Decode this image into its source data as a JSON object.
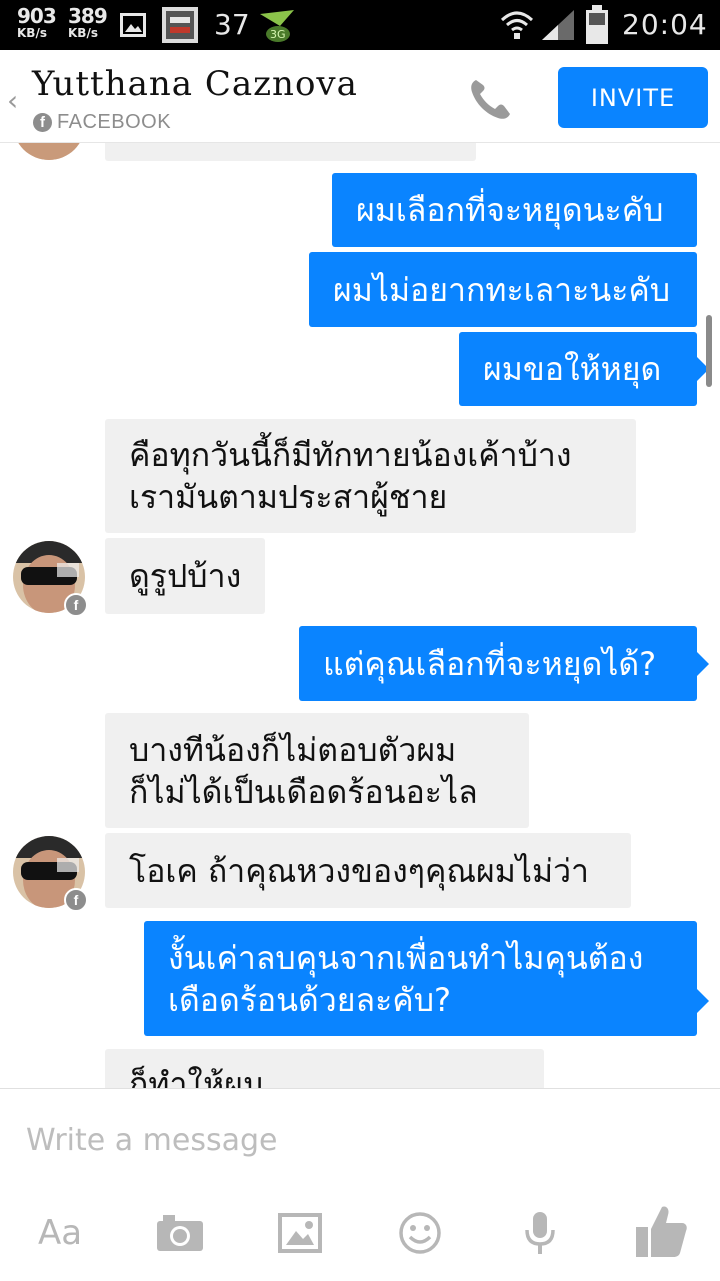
{
  "status_bar": {
    "down_speed": "903",
    "down_unit": "KB/s",
    "up_speed": "389",
    "up_unit": "KB/s",
    "notification_count": "37",
    "time": "20:04"
  },
  "header": {
    "back": "‹",
    "contact_name": "Yutthana Caznova",
    "source_badge": "f",
    "source": "FACEBOOK",
    "invite_label": "INVITE"
  },
  "messages": [
    {
      "side": "out",
      "lines": [
        "ผมเลือกที่จะหยุดนะคับ"
      ]
    },
    {
      "side": "out",
      "lines": [
        "ผมไม่อยากทะเลาะนะคับ"
      ]
    },
    {
      "side": "out",
      "lines": [
        "ผมขอให้หยุด"
      ]
    },
    {
      "side": "in",
      "lines": [
        "คือทุกวันนี้ก็มีทักทายน้องเค้าบ้าง",
        "เรามันตามประสาผู้ชาย"
      ]
    },
    {
      "side": "in",
      "lines": [
        "ดูรูปบ้าง"
      ]
    },
    {
      "side": "out",
      "lines": [
        "แต่คุณเลือกที่จะหยุดได้?"
      ]
    },
    {
      "side": "in",
      "lines": [
        "บางทีน้องก็ไม่ตอบตัวผม",
        "ก็ไม่ได้เป็นเดือดร้อนอะไล"
      ]
    },
    {
      "side": "in",
      "lines": [
        "โอเค ถ้าคุณหวงของๆคุณผมไม่ว่า"
      ]
    },
    {
      "side": "out",
      "lines": [
        "งั้นเค่าลบคุนจากเพื่อนทำไมคุนต้อง",
        "เดือดร้อนด้วยละคับ?"
      ]
    },
    {
      "side": "in",
      "lines": [
        "ก็ทำให้ผม"
      ]
    }
  ],
  "composer": {
    "placeholder": "Write a message",
    "text_tool_label": "Aa"
  },
  "colors": {
    "accent": "#0a84ff",
    "incoming_bubble": "#f0f0f0",
    "icon_gray": "#b7b7b7"
  },
  "icons": [
    "phone-icon",
    "camera-icon",
    "image-icon",
    "emoji-icon",
    "microphone-icon",
    "thumbs-up-icon"
  ]
}
